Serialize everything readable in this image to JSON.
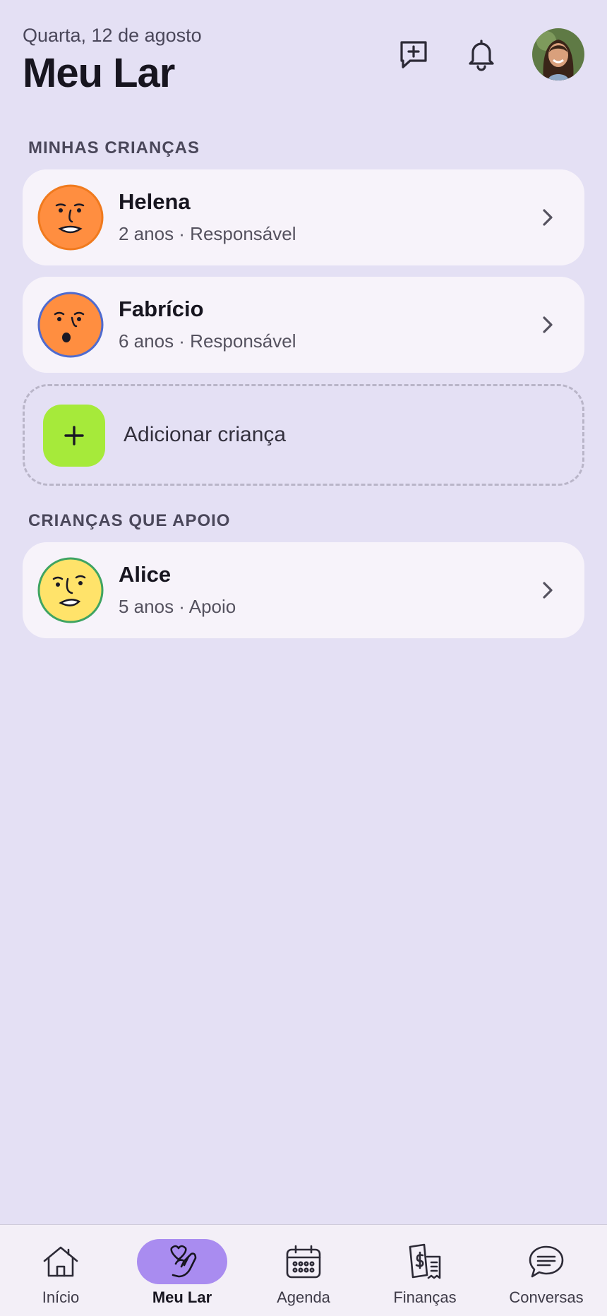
{
  "header": {
    "date": "Quarta, 12 de agosto",
    "title": "Meu Lar"
  },
  "sections": {
    "mine": "MINHAS CRIANÇAS",
    "support": "CRIANÇAS QUE APOIO"
  },
  "children": [
    {
      "name": "Helena",
      "subtitle": "2 anos · Responsável",
      "ring_color": "#F07A1E",
      "face_color": "#FF8E40"
    },
    {
      "name": "Fabrício",
      "subtitle": "6 anos · Responsável",
      "ring_color": "#4F6BCF",
      "face_color": "#FF8E40"
    }
  ],
  "add_child": {
    "label": "Adicionar criança",
    "color": "#A6EA3A"
  },
  "supported": [
    {
      "name": "Alice",
      "subtitle": "5 anos · Apoio",
      "ring_color": "#3FA462",
      "face_color": "#FFE36A"
    }
  ],
  "nav": {
    "items": [
      {
        "label": "Início",
        "icon": "house-icon"
      },
      {
        "label": "Meu Lar",
        "icon": "hand-heart-icon",
        "active": true
      },
      {
        "label": "Agenda",
        "icon": "calendar-icon"
      },
      {
        "label": "Finanças",
        "icon": "receipt-icon"
      },
      {
        "label": "Conversas",
        "icon": "chat-icon"
      }
    ],
    "active_color": "#A98CF0"
  },
  "colors": {
    "background": "#E4E0F4",
    "card": "#F7F3FA"
  }
}
